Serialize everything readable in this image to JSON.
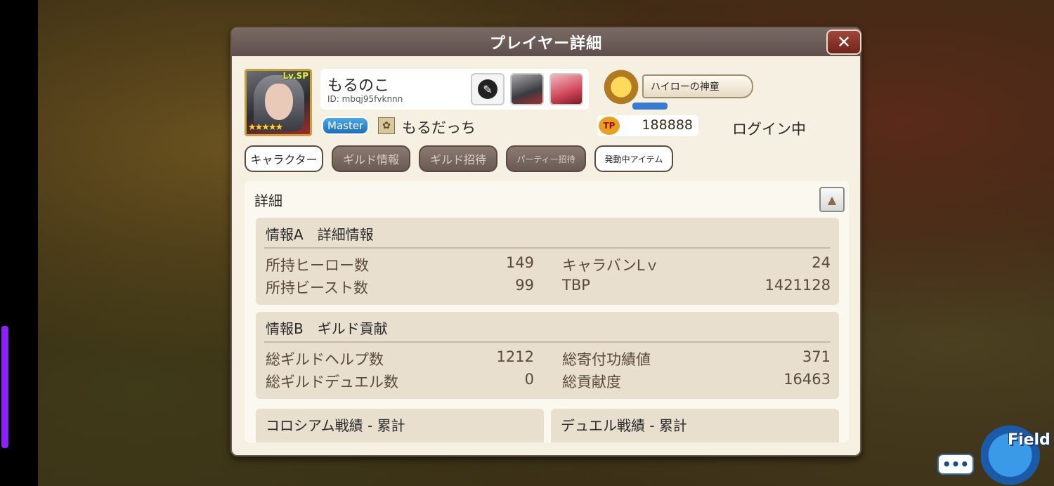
{
  "dialog": {
    "title": "プレイヤー詳細",
    "close_icon": "close-icon"
  },
  "player": {
    "level_badge": "Lv.SP",
    "stars": "★★★★★",
    "name": "もるのこ",
    "id": "ID: mbqj95fvknnn",
    "role_badge": "Master",
    "guild_name": "もるだっち",
    "rank_title": "ハイローの神童",
    "tbp_icon_text": "TP",
    "tbp_value": "188888",
    "login_status": "ログイン中"
  },
  "tabs": [
    {
      "label": "キャラクター"
    },
    {
      "label": "ギルド情報"
    },
    {
      "label": "ギルド招待"
    },
    {
      "label": "パーティー招待"
    },
    {
      "label": "発動中アイテム"
    }
  ],
  "details": {
    "title": "詳細",
    "section_a": {
      "title": "情報A　詳細情報",
      "rows": [
        {
          "label": "所持ヒーロー数",
          "value": "149",
          "label2": "キャラバンLｖ",
          "value2": "24"
        },
        {
          "label": "所持ビースト数",
          "value": "99",
          "label2": "TBP",
          "value2": "1421128"
        }
      ]
    },
    "section_b": {
      "title": "情報B　ギルド貢献",
      "rows": [
        {
          "label": "総ギルドヘルプ数",
          "value": "1212",
          "label2": "総寄付功績値",
          "value2": "371"
        },
        {
          "label": "総ギルドデュエル数",
          "value": "0",
          "label2": "総貢献度",
          "value2": "16463"
        }
      ]
    },
    "colosseum_title": "コロシアム戦績 - 累計",
    "duel_title": "デュエル戦績 - 累計"
  },
  "overlay": {
    "chat_glyph": "•••",
    "field_label": "Field"
  }
}
